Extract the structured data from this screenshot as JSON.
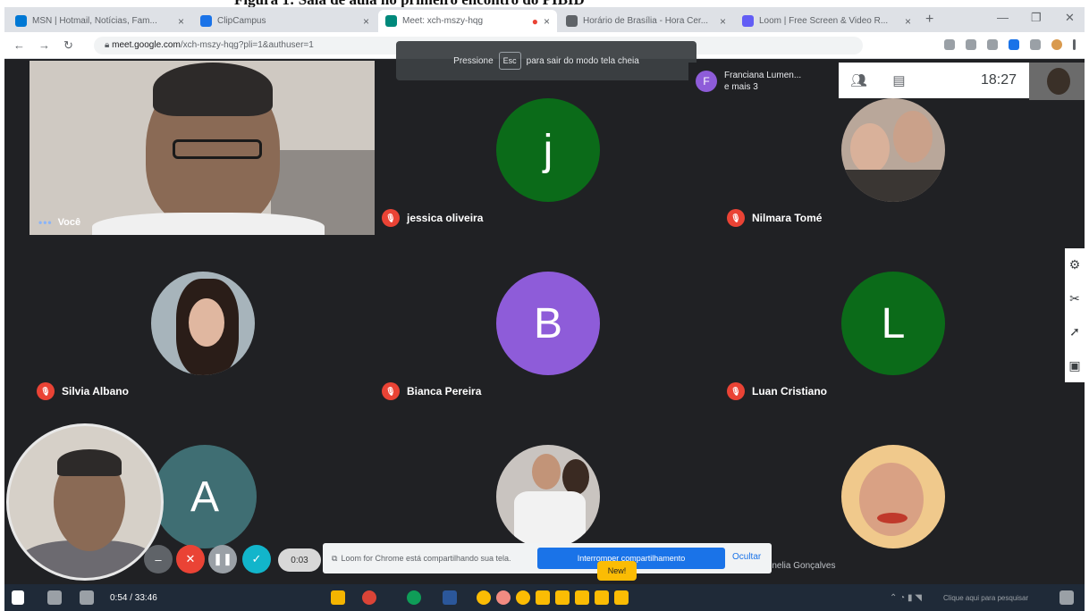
{
  "caption": "Figura 1: Sala de aula no primeiro encontro do PIBID",
  "browser": {
    "tabs": [
      {
        "label": "MSN | Hotmail, Notícias, Fam...",
        "color": "#0078d4"
      },
      {
        "label": "ClipCampus",
        "color": "#1a73e8"
      },
      {
        "label": "Meet: xch-mszy-hqg",
        "color": "#00897b"
      },
      {
        "label": "Horário de Brasília - Hora Cer...",
        "color": "#5f6368"
      },
      {
        "label": "Loom | Free Screen & Video R...",
        "color": "#625df5"
      }
    ],
    "url_host": "meet.google.com",
    "url_path": "/xch-mszy-hqg?pli=1&authuser=1"
  },
  "fullscreen_hint": {
    "before": "Pressione",
    "key": "Esc",
    "after": "para sair do modo tela cheia"
  },
  "meet": {
    "participants_summary": {
      "initial": "F",
      "name": "Franciana Lumen...",
      "more": "e mais 3"
    },
    "clock": "18:27",
    "self_label": "Você",
    "tiles": [
      {
        "name": "jessica oliveira",
        "initial": "j",
        "color": "#0b6b19"
      },
      {
        "name": "Nilmara Tomé"
      },
      {
        "name": "Silvia Albano"
      },
      {
        "name": "Bianca Pereira",
        "initial": "B",
        "color": "#8e5cd9"
      },
      {
        "name": "Luan Cristiano",
        "initial": "L",
        "color": "#0b6b19"
      },
      {
        "initial": "A",
        "color": "#3f6e73"
      },
      {
        "name": "...nelia Gonçalves"
      }
    ]
  },
  "loom": {
    "timer": "0:03",
    "share_text": "Loom for Chrome está compartilhando sua tela.",
    "stop_label": "Interromper compartilhamento",
    "hide_label": "Ocultar",
    "new_badge": "New!"
  },
  "taskbar": {
    "media_text": "0:54 / 33:46",
    "tray_text": "Clique aqui para pesquisar"
  }
}
